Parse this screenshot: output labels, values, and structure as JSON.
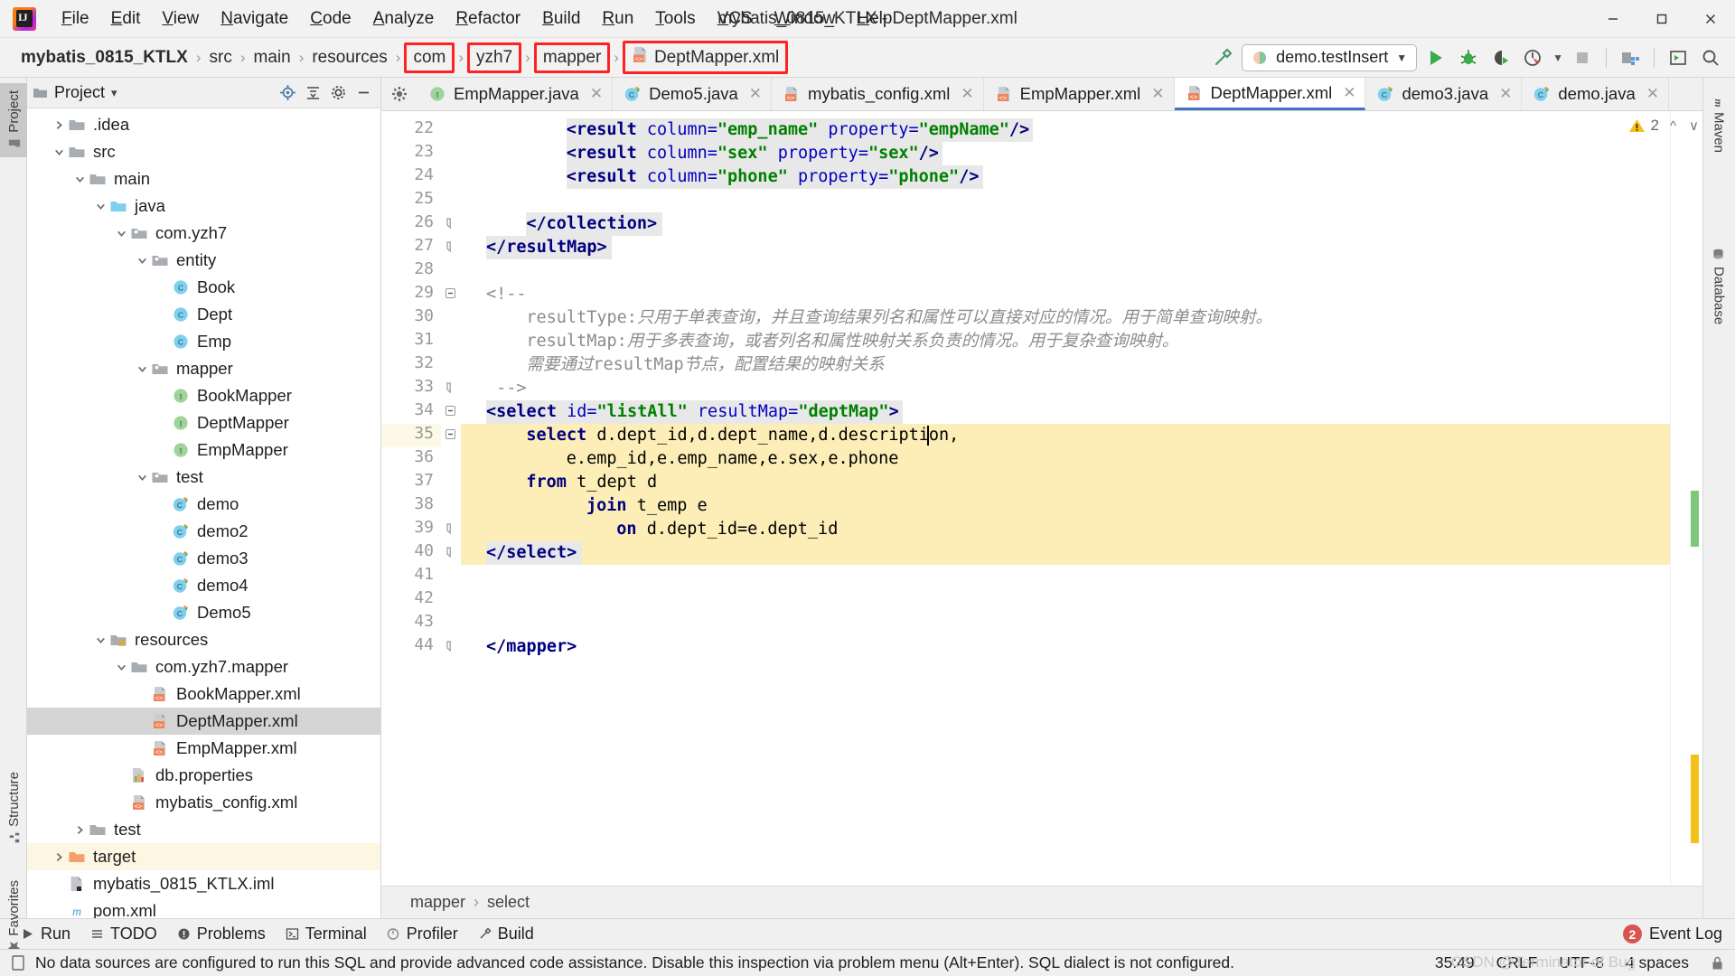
{
  "window": {
    "title": "mybatis_0815_KTLX - DeptMapper.xml",
    "minimize": "–",
    "maximize": "□",
    "close": "✕"
  },
  "menu": [
    "File",
    "Edit",
    "View",
    "Navigate",
    "Code",
    "Analyze",
    "Refactor",
    "Build",
    "Run",
    "Tools",
    "VCS",
    "Window",
    "Help"
  ],
  "breadcrumb": {
    "project": "mybatis_0815_KTLX",
    "items": [
      {
        "label": "src",
        "boxed": false,
        "icon": null
      },
      {
        "label": "main",
        "boxed": false,
        "icon": null
      },
      {
        "label": "resources",
        "boxed": false,
        "icon": null
      },
      {
        "label": "com",
        "boxed": true,
        "icon": null
      },
      {
        "label": "yzh7",
        "boxed": true,
        "icon": null
      },
      {
        "label": "mapper",
        "boxed": true,
        "icon": null
      },
      {
        "label": "DeptMapper.xml",
        "boxed": true,
        "icon": "xml-file-icon"
      }
    ],
    "separator": "›"
  },
  "toolbar": {
    "build_icon": "hammer-icon",
    "run_config": "demo.testInsert",
    "run_config_dropdown": "▼",
    "run_icon": "run-icon",
    "debug_icon": "debug-icon",
    "run_coverage_icon": "run-with-coverage-icon",
    "profiler_icon": "profiler-icon",
    "stop_icon": "stop-icon",
    "project_structure_icon": "project-structure-icon",
    "layout_icon": "layout-icon",
    "search_icon": "search-icon"
  },
  "left_strip": [
    {
      "label": "Project",
      "icon": "project-folder-icon",
      "selected": true
    },
    {
      "label": "Structure",
      "icon": "structure-icon",
      "selected": false
    },
    {
      "label": "Favorites",
      "icon": "star-icon",
      "selected": false
    }
  ],
  "right_strip": [
    {
      "label": "Maven",
      "icon": "maven-m-icon"
    },
    {
      "label": "Database",
      "icon": "database-icon"
    }
  ],
  "project_panel": {
    "title": "Project",
    "dropdown": "▾",
    "actions": [
      "locate-icon",
      "collapse-all-icon",
      "settings-gear-icon",
      "hide-icon"
    ],
    "tree": [
      {
        "label": ".idea",
        "depth": 1,
        "arrow": "collapsed",
        "icon": "folder-gray",
        "state": "none"
      },
      {
        "label": "src",
        "depth": 1,
        "arrow": "expanded",
        "icon": "folder-gray",
        "state": "none"
      },
      {
        "label": "main",
        "depth": 2,
        "arrow": "expanded",
        "icon": "folder-gray",
        "state": "none"
      },
      {
        "label": "java",
        "depth": 3,
        "arrow": "expanded",
        "icon": "folder-blue",
        "state": "none"
      },
      {
        "label": "com.yzh7",
        "depth": 4,
        "arrow": "expanded",
        "icon": "package",
        "state": "none"
      },
      {
        "label": "entity",
        "depth": 5,
        "arrow": "expanded",
        "icon": "package",
        "state": "none"
      },
      {
        "label": "Book",
        "depth": 6,
        "arrow": "none",
        "icon": "class",
        "state": "none"
      },
      {
        "label": "Dept",
        "depth": 6,
        "arrow": "none",
        "icon": "class",
        "state": "none"
      },
      {
        "label": "Emp",
        "depth": 6,
        "arrow": "none",
        "icon": "class",
        "state": "none"
      },
      {
        "label": "mapper",
        "depth": 5,
        "arrow": "expanded",
        "icon": "package",
        "state": "none"
      },
      {
        "label": "BookMapper",
        "depth": 6,
        "arrow": "none",
        "icon": "interface",
        "state": "none"
      },
      {
        "label": "DeptMapper",
        "depth": 6,
        "arrow": "none",
        "icon": "interface",
        "state": "none"
      },
      {
        "label": "EmpMapper",
        "depth": 6,
        "arrow": "none",
        "icon": "interface",
        "state": "none"
      },
      {
        "label": "test",
        "depth": 5,
        "arrow": "expanded",
        "icon": "package",
        "state": "none"
      },
      {
        "label": "demo",
        "depth": 6,
        "arrow": "none",
        "icon": "class-run",
        "state": "none"
      },
      {
        "label": "demo2",
        "depth": 6,
        "arrow": "none",
        "icon": "class-run",
        "state": "none"
      },
      {
        "label": "demo3",
        "depth": 6,
        "arrow": "none",
        "icon": "class-run",
        "state": "none"
      },
      {
        "label": "demo4",
        "depth": 6,
        "arrow": "none",
        "icon": "class-run",
        "state": "none"
      },
      {
        "label": "Demo5",
        "depth": 6,
        "arrow": "none",
        "icon": "class-run",
        "state": "none"
      },
      {
        "label": "resources",
        "depth": 3,
        "arrow": "expanded",
        "icon": "folder-res",
        "state": "none"
      },
      {
        "label": "com.yzh7.mapper",
        "depth": 4,
        "arrow": "expanded",
        "icon": "folder-gray",
        "state": "none"
      },
      {
        "label": "BookMapper.xml",
        "depth": 5,
        "arrow": "none",
        "icon": "xml",
        "state": "none"
      },
      {
        "label": "DeptMapper.xml",
        "depth": 5,
        "arrow": "none",
        "icon": "xml",
        "state": "selected"
      },
      {
        "label": "EmpMapper.xml",
        "depth": 5,
        "arrow": "none",
        "icon": "xml",
        "state": "none"
      },
      {
        "label": "db.properties",
        "depth": 4,
        "arrow": "none",
        "icon": "properties",
        "state": "none"
      },
      {
        "label": "mybatis_config.xml",
        "depth": 4,
        "arrow": "none",
        "icon": "xml",
        "state": "none"
      },
      {
        "label": "test",
        "depth": 2,
        "arrow": "collapsed",
        "icon": "folder-gray",
        "state": "none"
      },
      {
        "label": "target",
        "depth": 1,
        "arrow": "collapsed",
        "icon": "folder-orange",
        "state": "highlight"
      },
      {
        "label": "mybatis_0815_KTLX.iml",
        "depth": 1,
        "arrow": "none",
        "icon": "iml",
        "state": "none"
      },
      {
        "label": "pom.xml",
        "depth": 1,
        "arrow": "none",
        "icon": "maven-pom",
        "state": "none"
      }
    ]
  },
  "editor_tabs": [
    {
      "label": "EmpMapper.java",
      "icon": "interface",
      "active": false
    },
    {
      "label": "Demo5.java",
      "icon": "class-run",
      "active": false
    },
    {
      "label": "mybatis_config.xml",
      "icon": "xml",
      "active": false
    },
    {
      "label": "EmpMapper.xml",
      "icon": "xml",
      "active": false
    },
    {
      "label": "DeptMapper.xml",
      "icon": "xml",
      "active": true
    },
    {
      "label": "demo3.java",
      "icon": "class-run",
      "active": false
    },
    {
      "label": "demo.java",
      "icon": "class-run",
      "active": false
    }
  ],
  "inspection": {
    "warning_count": "2",
    "warning_icon": "warning-triangle-icon",
    "prev_icon": "ⱏ",
    "next_icon": "ⱟ"
  },
  "code": {
    "first_line": 22,
    "lines": [
      {
        "n": 22,
        "fold": null,
        "hl": "sel",
        "indent": 8,
        "tokens": [
          {
            "t": "<result ",
            "c": "tag"
          },
          {
            "t": "column=",
            "c": "attr"
          },
          {
            "t": "\"emp_name\"",
            "c": "val"
          },
          {
            "t": " ",
            "c": "plain"
          },
          {
            "t": "property=",
            "c": "attr"
          },
          {
            "t": "\"empName\"",
            "c": "val"
          },
          {
            "t": "/>",
            "c": "tag"
          }
        ]
      },
      {
        "n": 23,
        "fold": null,
        "hl": "sel",
        "indent": 8,
        "tokens": [
          {
            "t": "<result ",
            "c": "tag"
          },
          {
            "t": "column=",
            "c": "attr"
          },
          {
            "t": "\"sex\"",
            "c": "val"
          },
          {
            "t": " ",
            "c": "plain"
          },
          {
            "t": "property=",
            "c": "attr"
          },
          {
            "t": "\"sex\"",
            "c": "val"
          },
          {
            "t": "/>",
            "c": "tag"
          }
        ]
      },
      {
        "n": 24,
        "fold": null,
        "hl": "sel",
        "indent": 8,
        "tokens": [
          {
            "t": "<result ",
            "c": "tag"
          },
          {
            "t": "column=",
            "c": "attr"
          },
          {
            "t": "\"phone\"",
            "c": "val"
          },
          {
            "t": " ",
            "c": "plain"
          },
          {
            "t": "property=",
            "c": "attr"
          },
          {
            "t": "\"phone\"",
            "c": "val"
          },
          {
            "t": "/>",
            "c": "tag"
          }
        ]
      },
      {
        "n": 25,
        "fold": null,
        "hl": "none",
        "indent": 0,
        "tokens": []
      },
      {
        "n": 26,
        "fold": "end",
        "hl": "sel",
        "indent": 4,
        "tokens": [
          {
            "t": "</collection>",
            "c": "tag"
          }
        ]
      },
      {
        "n": 27,
        "fold": "end",
        "hl": "sel",
        "indent": 0,
        "tokens": [
          {
            "t": "</resultMap>",
            "c": "tag"
          }
        ]
      },
      {
        "n": 28,
        "fold": null,
        "hl": "none",
        "indent": 0,
        "tokens": []
      },
      {
        "n": 29,
        "fold": "start",
        "hl": "none",
        "indent": 0,
        "tokens": [
          {
            "t": "<!--",
            "c": "cmtb"
          }
        ]
      },
      {
        "n": 30,
        "fold": null,
        "hl": "none",
        "indent": 4,
        "tokens": [
          {
            "t": "resultType:",
            "c": "cmtb"
          },
          {
            "t": "只用于单表查询，并且查询结果列名和属性可以直接对应的情况。用于简单查询映射。",
            "c": "cmt"
          }
        ]
      },
      {
        "n": 31,
        "fold": null,
        "hl": "none",
        "indent": 4,
        "tokens": [
          {
            "t": "resultMap:",
            "c": "cmtb"
          },
          {
            "t": "用于多表查询，或者列名和属性映射关系负责的情况。用于复杂查询映射。",
            "c": "cmt"
          }
        ]
      },
      {
        "n": 32,
        "fold": null,
        "hl": "none",
        "indent": 4,
        "tokens": [
          {
            "t": "需要通过",
            "c": "cmt"
          },
          {
            "t": "resultMap",
            "c": "cmtb"
          },
          {
            "t": "节点，配置结果的映射关系",
            "c": "cmt"
          }
        ]
      },
      {
        "n": 33,
        "fold": "end",
        "hl": "none",
        "indent": 1,
        "tokens": [
          {
            "t": "-->",
            "c": "cmtb"
          }
        ]
      },
      {
        "n": 34,
        "fold": "start",
        "hl": "sql-top",
        "indent": 0,
        "tokens": [
          {
            "t": "<select ",
            "c": "tag"
          },
          {
            "t": "id=",
            "c": "attr"
          },
          {
            "t": "\"listAll\"",
            "c": "val"
          },
          {
            "t": " ",
            "c": "plain"
          },
          {
            "t": "resultMap=",
            "c": "attr"
          },
          {
            "t": "\"deptMap\"",
            "c": "val"
          },
          {
            "t": ">",
            "c": "tag"
          }
        ]
      },
      {
        "n": 35,
        "fold": "start",
        "hl": "sql-caret",
        "indent": 4,
        "tokens": [
          {
            "t": "select",
            "c": "sqlkw"
          },
          {
            "t": " d.dept_id,d.dept_name,d.description,",
            "c": "plain"
          }
        ]
      },
      {
        "n": 36,
        "fold": null,
        "hl": "sql",
        "indent": 8,
        "tokens": [
          {
            "t": "e.emp_id,e.emp_name,e.sex,e.phone",
            "c": "plain"
          }
        ]
      },
      {
        "n": 37,
        "fold": null,
        "hl": "sql",
        "indent": 4,
        "tokens": [
          {
            "t": "from",
            "c": "sqlkw"
          },
          {
            "t": " t_dept d",
            "c": "plain"
          }
        ]
      },
      {
        "n": 38,
        "fold": null,
        "hl": "sql",
        "indent": 10,
        "tokens": [
          {
            "t": "join",
            "c": "sqlkw"
          },
          {
            "t": " t_emp e",
            "c": "plain"
          }
        ]
      },
      {
        "n": 39,
        "fold": "end",
        "hl": "sql",
        "indent": 13,
        "tokens": [
          {
            "t": "on",
            "c": "sqlkw"
          },
          {
            "t": " d.dept_id=e.dept_id",
            "c": "plain"
          }
        ]
      },
      {
        "n": 40,
        "fold": "end",
        "hl": "sql-bot",
        "indent": 0,
        "tokens": [
          {
            "t": "</select>",
            "c": "tag"
          }
        ]
      },
      {
        "n": 41,
        "fold": null,
        "hl": "none",
        "indent": 0,
        "tokens": []
      },
      {
        "n": 42,
        "fold": null,
        "hl": "none",
        "indent": 0,
        "tokens": []
      },
      {
        "n": 43,
        "fold": null,
        "hl": "none",
        "indent": 0,
        "tokens": []
      },
      {
        "n": 44,
        "fold": "end",
        "hl": "none",
        "indent": 0,
        "tokens": [
          {
            "t": "</mapper>",
            "c": "tag"
          }
        ]
      }
    ]
  },
  "editor_breadcrumb": {
    "items": [
      "mapper",
      "select"
    ],
    "separator": "›"
  },
  "bottom_bar": {
    "items": [
      {
        "label": "Run",
        "icon": "run-icon"
      },
      {
        "label": "TODO",
        "icon": "todo-icon"
      },
      {
        "label": "Problems",
        "icon": "problems-icon"
      },
      {
        "label": "Terminal",
        "icon": "terminal-icon"
      },
      {
        "label": "Profiler",
        "icon": "profiler-icon"
      },
      {
        "label": "Build",
        "icon": "build-hammer-icon"
      }
    ],
    "event_log": "Event Log",
    "event_count": "2"
  },
  "status_bar": {
    "icon": "inspection-doc-icon",
    "message": "No data sources are configured to run this SQL and provide advanced code assistance. Disable this inspection via problem menu (Alt+Enter). SQL dialect is not configured.",
    "position": "35:49",
    "line_separator": "CRLF",
    "encoding": "UTF-8",
    "indent": "4 spaces",
    "lock_icon": "lock-icon"
  },
  "watermark": "CSDN @Terminator of Bug",
  "colors": {
    "accent": "#4073c4",
    "annotation_red": "#ff2222",
    "sql_highlight": "#fdeeb7",
    "selection_gray": "#e8e8e8",
    "folder_orange": "#f4a460"
  }
}
